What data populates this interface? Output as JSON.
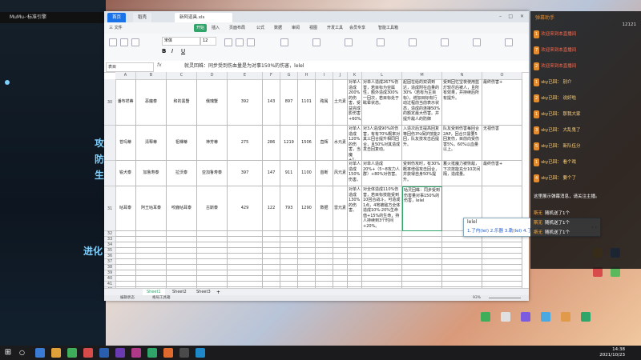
{
  "stream": {
    "tab_title": "MuMu-·标准引擎",
    "side_texts": [
      "攻",
      "防",
      "生",
      "进化"
    ]
  },
  "window": {
    "tabs": [
      {
        "label": "首页"
      },
      {
        "label": "稻壳"
      },
      {
        "label": "新阿道具.xls"
      }
    ],
    "menu": [
      "三 文件",
      "开始",
      "插入",
      "页面布局",
      "公式",
      "数据",
      "审阅",
      "视图",
      "开发工具",
      "会员专享",
      "智能工具箱"
    ],
    "font_name": "宋体",
    "font_size": "12",
    "namebox": "表目",
    "formula": "就灵回蛛：同步受到伤血量是为对事150%的伤害，lelel",
    "columns": [
      "A",
      "B",
      "C",
      "D",
      "E",
      "F",
      "G",
      "H",
      "I",
      "J",
      "K",
      "L",
      "M",
      "N",
      "O"
    ],
    "rows": [
      {
        "num": "30",
        "cells": [
          "潘布祥蒂",
          "恶魔泰",
          "和的黑蟹",
          "俄瑰蟹",
          "392",
          "143",
          "897",
          "1101",
          "跨属",
          "土元素",
          "对单人造成200%的伤害，受益完成影伤害+60%。",
          "对单人造成267%伤害，若目标为亚属性，额外造成300%一回次，若目标处于眩晕状态。",
          "起因在给的双调到达，造成附在血量的30%（若有为主目标），增加目标有行动过程前当前表示状态，造成的连接50%的额定最大伤害。并提升敌人的防御",
          "受到回忆宝夜使用蓝灯较尽后被人，且所有效果，并持续后所有提升。",
          "最终伤害+"
        ]
      },
      {
        "num": "",
        "cells": [
          "苍玛蒂",
          "清释蒂",
          "祖裸蒂",
          "神芳蒂",
          "275",
          "286",
          "1219",
          "1506",
          "直辉",
          "水元素",
          "对单人造成120%的伤害，当魔+1。",
          "对3人造成90%的伤害，有有70%概率对其三回合提升相同回合，且50%对其造成发击回复动。",
          "入造次后支提高回复等回伤3%保护技能2回，队友技攻击后提升。",
          "队友受到伤害每回合2AP，回合只需要5回复伤，目前向受伤害5%，60%以血量以上。",
          "无视伤害"
        ]
      },
      {
        "num": "",
        "cells": [
          "锐犬泰",
          "加鲁寿泰",
          "拉沃泰",
          "亚加鲁寿泰",
          "397",
          "147",
          "911",
          "1100",
          "首断",
          "风元素",
          "对单人造成150%伤害。",
          "对单人造成20%+（5~8攻力人群）+80%对伤害。",
          "受到伤攻时，有30%概率增强攻击回合，并获得自身50%提升。",
          "蓄火抵魔力被恢敌，下次技能充分10次间隔，造成量。",
          "最终伤害+"
        ]
      },
      {
        "num": "31",
        "cells": [
          "咕耳泰",
          "阿王咕耳泰",
          "咬鹿咕耳泰",
          "古斯泰",
          "429",
          "122",
          "793",
          "1290",
          "数据",
          "雷元素",
          "对单人造成130%的伤害。",
          "对全体造成110%伤害，若目标技能受到10回合战斗，可造成1点，4地被敌方全体造成10%-20%生命值+15%的生命，持人持续到3个时间+20%。",
          "咕灵回蛛：同步受到伤害量对事150%的伤害，lelel",
          "",
          ""
        ]
      }
    ],
    "empty_rows": [
      "32",
      "33",
      "34",
      "35",
      "36",
      "37",
      "38",
      "39",
      "40",
      "41",
      "42",
      "43",
      "44",
      "45",
      "46"
    ],
    "sheets": [
      "Sheet1",
      "Sheet2",
      "Sheet3"
    ],
    "status_left": "编辑状态",
    "status_mid": "格局工具箱",
    "zoom": "93%"
  },
  "ime": {
    "input": "lelel",
    "candidates": "1.了内(lel)  2.乐器  3.勒(lel)  4.了  5.乐"
  },
  "chat": {
    "title": "弹幕助手",
    "count": "12121",
    "rows": [
      {
        "badge": "1",
        "text": "欢迎来到本直播间"
      },
      {
        "badge": "7",
        "text": "欢迎来到本直播间"
      },
      {
        "badge": "2",
        "text": "欢迎来到本直播间"
      },
      {
        "badge": "1",
        "text": "sky已回： 别介"
      },
      {
        "badge": "2",
        "text": "sky已回： 说好啦"
      },
      {
        "badge": "1",
        "text": "sky已回： 那我大家"
      },
      {
        "badge": "3",
        "text": "sky已回： 大乱鬼了"
      },
      {
        "badge": "5",
        "text": "sky已回： 新队伍分"
      },
      {
        "badge": "1",
        "text": "sky已回： 看个戏"
      },
      {
        "badge": "4",
        "text": "sky已回： 要个了"
      }
    ],
    "notice": "这里展示弹幕消息，请关注主播。",
    "gifts": [
      {
        "name": "斯无",
        "text": "随机送了1个"
      },
      {
        "name": "斯无",
        "text": "随机送了1个"
      },
      {
        "name": "斯无",
        "text": "随机送了1个"
      }
    ]
  },
  "taskbar": {
    "time": "14:38",
    "date": "2021/10/23"
  },
  "colors": {
    "accent": "#1a73e8",
    "wps_green": "#2fa56a",
    "chat_badge": "#e38b2d"
  }
}
